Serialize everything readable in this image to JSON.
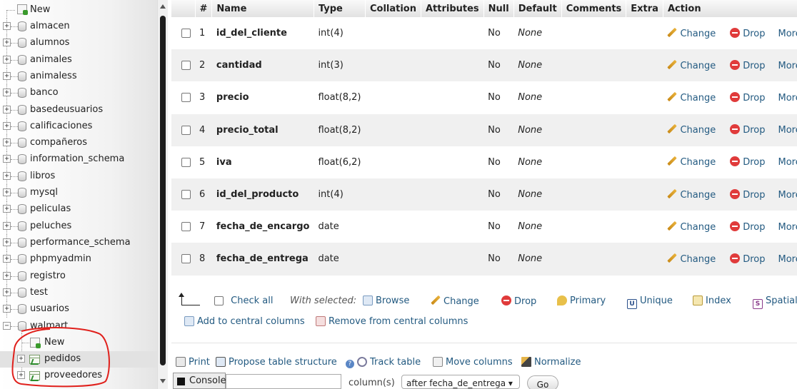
{
  "sidebar": {
    "new_label": "New",
    "databases": [
      "almacen",
      "alumnos",
      "animales",
      "animaless",
      "banco",
      "basedeusuarios",
      "calificaciones",
      "compañeros",
      "information_schema",
      "libros",
      "mysql",
      "peliculas",
      "peluches",
      "performance_schema",
      "phpmyadmin",
      "registro",
      "test",
      "usuarios"
    ],
    "expanded_db": "walmart",
    "expanded_new_label": "New",
    "tables": [
      "pedidos",
      "proveedores"
    ]
  },
  "table": {
    "headers": [
      "#",
      "Name",
      "Type",
      "Collation",
      "Attributes",
      "Null",
      "Default",
      "Comments",
      "Extra",
      "Action"
    ],
    "rows": [
      {
        "num": "1",
        "name": "id_del_cliente",
        "type": "int(4)",
        "null": "No",
        "default": "None"
      },
      {
        "num": "2",
        "name": "cantidad",
        "type": "int(3)",
        "null": "No",
        "default": "None"
      },
      {
        "num": "3",
        "name": "precio",
        "type": "float(8,2)",
        "null": "No",
        "default": "None"
      },
      {
        "num": "4",
        "name": "precio_total",
        "type": "float(8,2)",
        "null": "No",
        "default": "None"
      },
      {
        "num": "5",
        "name": "iva",
        "type": "float(6,2)",
        "null": "No",
        "default": "None"
      },
      {
        "num": "6",
        "name": "id_del_producto",
        "type": "int(4)",
        "null": "No",
        "default": "None"
      },
      {
        "num": "7",
        "name": "fecha_de_encargo",
        "type": "date",
        "null": "No",
        "default": "None"
      },
      {
        "num": "8",
        "name": "fecha_de_entrega",
        "type": "date",
        "null": "No",
        "default": "None"
      }
    ],
    "actions": {
      "change": "Change",
      "drop": "Drop",
      "more": "More"
    }
  },
  "bulk": {
    "check_all": "Check all",
    "with_selected": "With selected:",
    "browse": "Browse",
    "change": "Change",
    "drop": "Drop",
    "primary": "Primary",
    "unique": "Unique",
    "index": "Index",
    "spatial": "Spatial",
    "add_central": "Add to central columns",
    "remove_central": "Remove from central columns"
  },
  "tools": {
    "print": "Print",
    "propose": "Propose table structure",
    "track": "Track table",
    "move": "Move columns",
    "normalize": "Normalize"
  },
  "bottom": {
    "console": "Console",
    "columns_label": "column(s)",
    "after_value": "after fecha_de_entrega",
    "go": "Go"
  },
  "colors": {
    "link": "#235a81",
    "annotation": "#e0201c",
    "drop": "#e03b3b"
  }
}
